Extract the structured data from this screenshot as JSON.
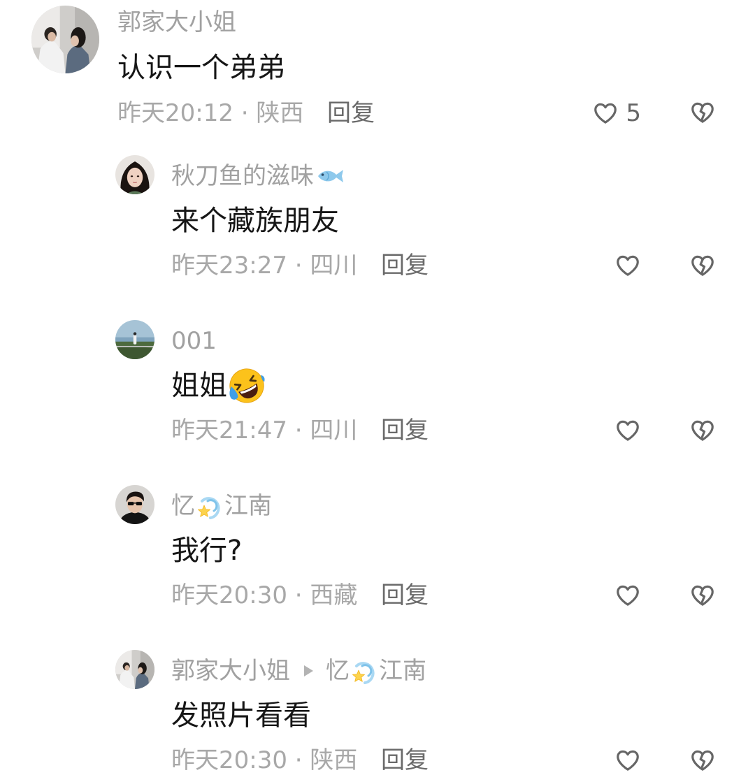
{
  "comment": {
    "username": "郭家大小姐",
    "text": "认识一个弟弟",
    "meta": "昨天20:12 · 陕西",
    "reply_label": "回复",
    "like_count": "5"
  },
  "replies": [
    {
      "username": "秋刀鱼的滋味",
      "username_emoji": "fish-emoji",
      "text": "来个藏族朋友",
      "meta": "昨天23:27 · 四川",
      "reply_label": "回复"
    },
    {
      "username": "001",
      "text": "姐姐",
      "text_emoji": "rolling-on-the-floor-laughing-emoji",
      "meta": "昨天21:47 · 四川",
      "reply_label": "回复"
    },
    {
      "username_before_emoji": "忆",
      "username_emoji": "dizzy-emoji",
      "username_after_emoji": "江南",
      "text": "我行?",
      "meta": "昨天20:30 · 西藏",
      "reply_label": "回复"
    },
    {
      "username": "郭家大小姐",
      "reply_to_icon": "play-arrow-icon",
      "reply_to_before_emoji": "忆",
      "reply_to_emoji": "dizzy-emoji",
      "reply_to_after_emoji": "江南",
      "text": "发照片看看",
      "meta": "昨天20:30 · 陕西",
      "reply_label": "回复"
    }
  ],
  "icons": {
    "like": "heart-outline-icon",
    "dislike": "broken-heart-icon"
  },
  "colors": {
    "background": "#ffffff",
    "username": "#a1a1a1",
    "text": "#161616",
    "meta": "#a8a8a8",
    "reply": "#6a6a6a",
    "icon": "#666666"
  }
}
